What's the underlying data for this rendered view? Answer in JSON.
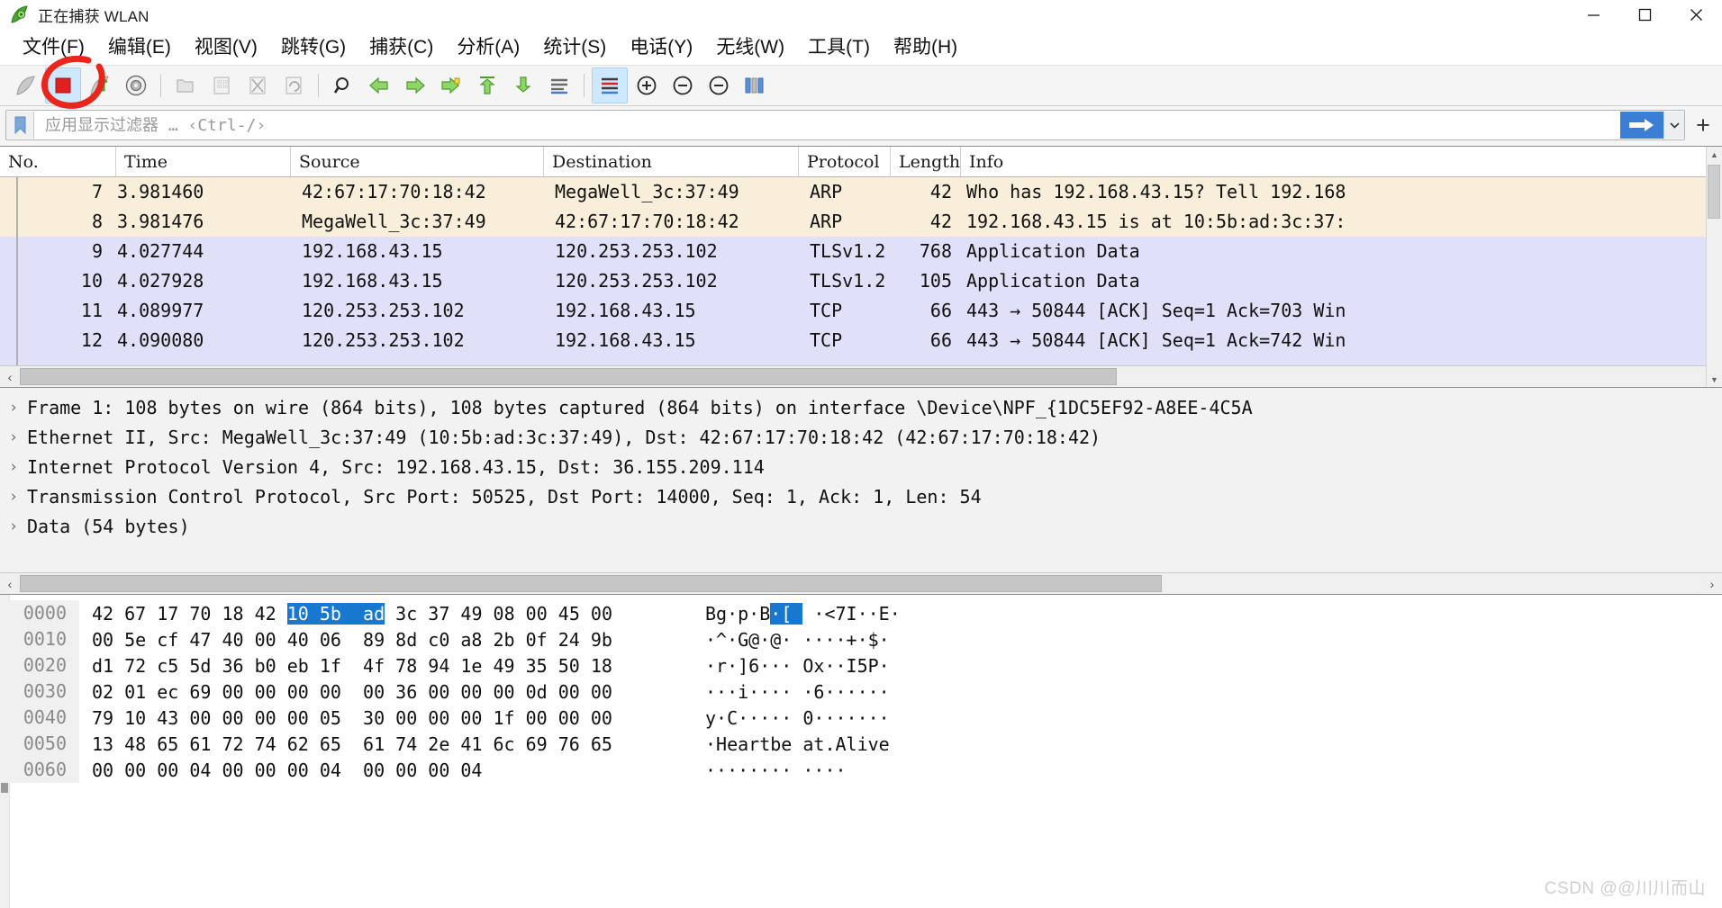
{
  "window": {
    "title": "正在捕获 WLAN",
    "app_icon": "wireshark-sharkfin-icon",
    "controls": {
      "minimize": "minimize-icon",
      "maximize": "maximize-icon",
      "close": "close-icon"
    }
  },
  "menubar": {
    "items": [
      {
        "label": "文件(F)",
        "name": "menu-file"
      },
      {
        "label": "编辑(E)",
        "name": "menu-edit"
      },
      {
        "label": "视图(V)",
        "name": "menu-view"
      },
      {
        "label": "跳转(G)",
        "name": "menu-go"
      },
      {
        "label": "捕获(C)",
        "name": "menu-capture"
      },
      {
        "label": "分析(A)",
        "name": "menu-analyze"
      },
      {
        "label": "统计(S)",
        "name": "menu-statistics"
      },
      {
        "label": "电话(Y)",
        "name": "menu-telephony"
      },
      {
        "label": "无线(W)",
        "name": "menu-wireless"
      },
      {
        "label": "工具(T)",
        "name": "menu-tools"
      },
      {
        "label": "帮助(H)",
        "name": "menu-help"
      }
    ]
  },
  "toolbar": {
    "annotation": "red-circle-annotation-on-stop-capture",
    "buttons": [
      {
        "name": "start-capture-button",
        "icon": "shark-fin-icon",
        "enabled": false
      },
      {
        "name": "stop-capture-button",
        "icon": "stop-square-icon",
        "enabled": true,
        "annotated": true
      },
      {
        "name": "restart-capture-button",
        "icon": "restart-arrow-icon",
        "enabled": true
      },
      {
        "name": "capture-options-button",
        "icon": "gear-icon",
        "enabled": true
      },
      {
        "name": "open-file-button",
        "icon": "folder-icon",
        "enabled": false
      },
      {
        "name": "save-button",
        "icon": "save-disk-icon",
        "enabled": false
      },
      {
        "name": "close-file-button",
        "icon": "close-x-icon",
        "enabled": false
      },
      {
        "name": "reload-button",
        "icon": "reload-icon",
        "enabled": false
      },
      {
        "name": "find-packet-button",
        "icon": "magnifier-icon",
        "enabled": true
      },
      {
        "name": "go-back-button",
        "icon": "arrow-left-icon",
        "enabled": true
      },
      {
        "name": "go-forward-button",
        "icon": "arrow-right-icon",
        "enabled": true
      },
      {
        "name": "go-to-packet-button",
        "icon": "goto-packet-icon",
        "enabled": true
      },
      {
        "name": "go-to-first-button",
        "icon": "arrow-up-first-icon",
        "enabled": true
      },
      {
        "name": "go-to-last-button",
        "icon": "arrow-down-last-icon",
        "enabled": true
      },
      {
        "name": "auto-scroll-button",
        "icon": "auto-scroll-icon",
        "enabled": true
      },
      {
        "name": "colorize-button",
        "icon": "colorize-packets-icon",
        "enabled": true,
        "selected": true
      },
      {
        "name": "zoom-in-button",
        "icon": "zoom-in-icon",
        "enabled": true
      },
      {
        "name": "zoom-out-button",
        "icon": "zoom-out-icon",
        "enabled": true
      },
      {
        "name": "zoom-reset-button",
        "icon": "zoom-reset-icon",
        "enabled": true
      },
      {
        "name": "resize-columns-button",
        "icon": "resize-columns-icon",
        "enabled": true
      }
    ]
  },
  "filter": {
    "bookmark_icon": "bookmark-icon",
    "placeholder": "应用显示过滤器 … ‹Ctrl-/›",
    "value": "",
    "apply_icon": "arrow-right-apply-icon",
    "dropdown_icon": "chevron-down-icon",
    "add_icon": "plus-icon"
  },
  "packet_list": {
    "columns": [
      {
        "label": "No.",
        "name": "column-no"
      },
      {
        "label": "Time",
        "name": "column-time"
      },
      {
        "label": "Source",
        "name": "column-source"
      },
      {
        "label": "Destination",
        "name": "column-destination"
      },
      {
        "label": "Protocol",
        "name": "column-protocol"
      },
      {
        "label": "Length",
        "name": "column-length"
      },
      {
        "label": "Info",
        "name": "column-info"
      }
    ],
    "rows": [
      {
        "no": "7",
        "time": "3.981460",
        "source": "42:67:17:70:18:42",
        "destination": "MegaWell_3c:37:49",
        "protocol": "ARP",
        "length": "42",
        "info": "Who has 192.168.43.15? Tell 192.168",
        "style": "arp"
      },
      {
        "no": "8",
        "time": "3.981476",
        "source": "MegaWell_3c:37:49",
        "destination": "42:67:17:70:18:42",
        "protocol": "ARP",
        "length": "42",
        "info": "192.168.43.15 is at 10:5b:ad:3c:37:",
        "style": "arp"
      },
      {
        "no": "9",
        "time": "4.027744",
        "source": "192.168.43.15",
        "destination": "120.253.253.102",
        "protocol": "TLSv1.2",
        "length": "768",
        "info": "Application Data",
        "style": "tls"
      },
      {
        "no": "10",
        "time": "4.027928",
        "source": "192.168.43.15",
        "destination": "120.253.253.102",
        "protocol": "TLSv1.2",
        "length": "105",
        "info": "Application Data",
        "style": "tls"
      },
      {
        "no": "11",
        "time": "4.089977",
        "source": "120.253.253.102",
        "destination": "192.168.43.15",
        "protocol": "TCP",
        "length": "66",
        "info": "443 → 50844 [ACK] Seq=1 Ack=703 Win",
        "style": "tcp"
      },
      {
        "no": "12",
        "time": "4.090080",
        "source": "120.253.253.102",
        "destination": "192.168.43.15",
        "protocol": "TCP",
        "length": "66",
        "info": "443 → 50844 [ACK] Seq=1 Ack=742 Win",
        "style": "tcp"
      }
    ]
  },
  "packet_detail": {
    "rows": [
      {
        "caret": "›",
        "text": "Frame 1: 108 bytes on wire (864 bits), 108 bytes captured (864 bits) on interface \\Device\\NPF_{1DC5EF92-A8EE-4C5A"
      },
      {
        "caret": "›",
        "text": "Ethernet II, Src: MegaWell_3c:37:49 (10:5b:ad:3c:37:49), Dst: 42:67:17:70:18:42 (42:67:17:70:18:42)"
      },
      {
        "caret": "›",
        "text": "Internet Protocol Version 4, Src: 192.168.43.15, Dst: 36.155.209.114"
      },
      {
        "caret": "›",
        "text": "Transmission Control Protocol, Src Port: 50525, Dst Port: 14000, Seq: 1, Ack: 1, Len: 54"
      },
      {
        "caret": "›",
        "text": "Data (54 bytes)"
      }
    ]
  },
  "packet_bytes": {
    "rows": [
      {
        "offset": "0000",
        "hex_pre": "42 67 17 70 18 42 ",
        "hex_hl": "10 5b  ad",
        "hex_post": " 3c 37 49 08 00 45 00",
        "ascii_pre": "Bg·p·B",
        "ascii_hl": "·[ ",
        "ascii_post": " ·<7I··E·"
      },
      {
        "offset": "0010",
        "hex_pre": "",
        "hex_hl": "",
        "hex_post": "00 5e cf 47 40 00 40 06  89 8d c0 a8 2b 0f 24 9b",
        "ascii_pre": "",
        "ascii_hl": "",
        "ascii_post": "·^·G@·@· ····+·$·"
      },
      {
        "offset": "0020",
        "hex_pre": "",
        "hex_hl": "",
        "hex_post": "d1 72 c5 5d 36 b0 eb 1f  4f 78 94 1e 49 35 50 18",
        "ascii_pre": "",
        "ascii_hl": "",
        "ascii_post": "·r·]6··· Ox··I5P·"
      },
      {
        "offset": "0030",
        "hex_pre": "",
        "hex_hl": "",
        "hex_post": "02 01 ec 69 00 00 00 00  00 36 00 00 00 0d 00 00",
        "ascii_pre": "",
        "ascii_hl": "",
        "ascii_post": "···i···· ·6······"
      },
      {
        "offset": "0040",
        "hex_pre": "",
        "hex_hl": "",
        "hex_post": "79 10 43 00 00 00 00 05  30 00 00 00 1f 00 00 00",
        "ascii_pre": "",
        "ascii_hl": "",
        "ascii_post": "y·C····· 0·······"
      },
      {
        "offset": "0050",
        "hex_pre": "",
        "hex_hl": "",
        "hex_post": "13 48 65 61 72 74 62 65  61 74 2e 41 6c 69 76 65",
        "ascii_pre": "",
        "ascii_hl": "",
        "ascii_post": "·Heartbe at.Alive"
      },
      {
        "offset": "0060",
        "hex_pre": "",
        "hex_hl": "",
        "hex_post": "00 00 00 04 00 00 00 04  00 00 00 04",
        "ascii_pre": "",
        "ascii_hl": "",
        "ascii_post": "········ ····"
      }
    ]
  },
  "watermark": {
    "text": "CSDN @@川川而山"
  },
  "colors": {
    "arp_row": "#f8eed9",
    "tls_row": "#e0e0f8",
    "highlight": "#1878d0",
    "apply_button": "#3b7fd4",
    "annotation": "#e8261b"
  }
}
